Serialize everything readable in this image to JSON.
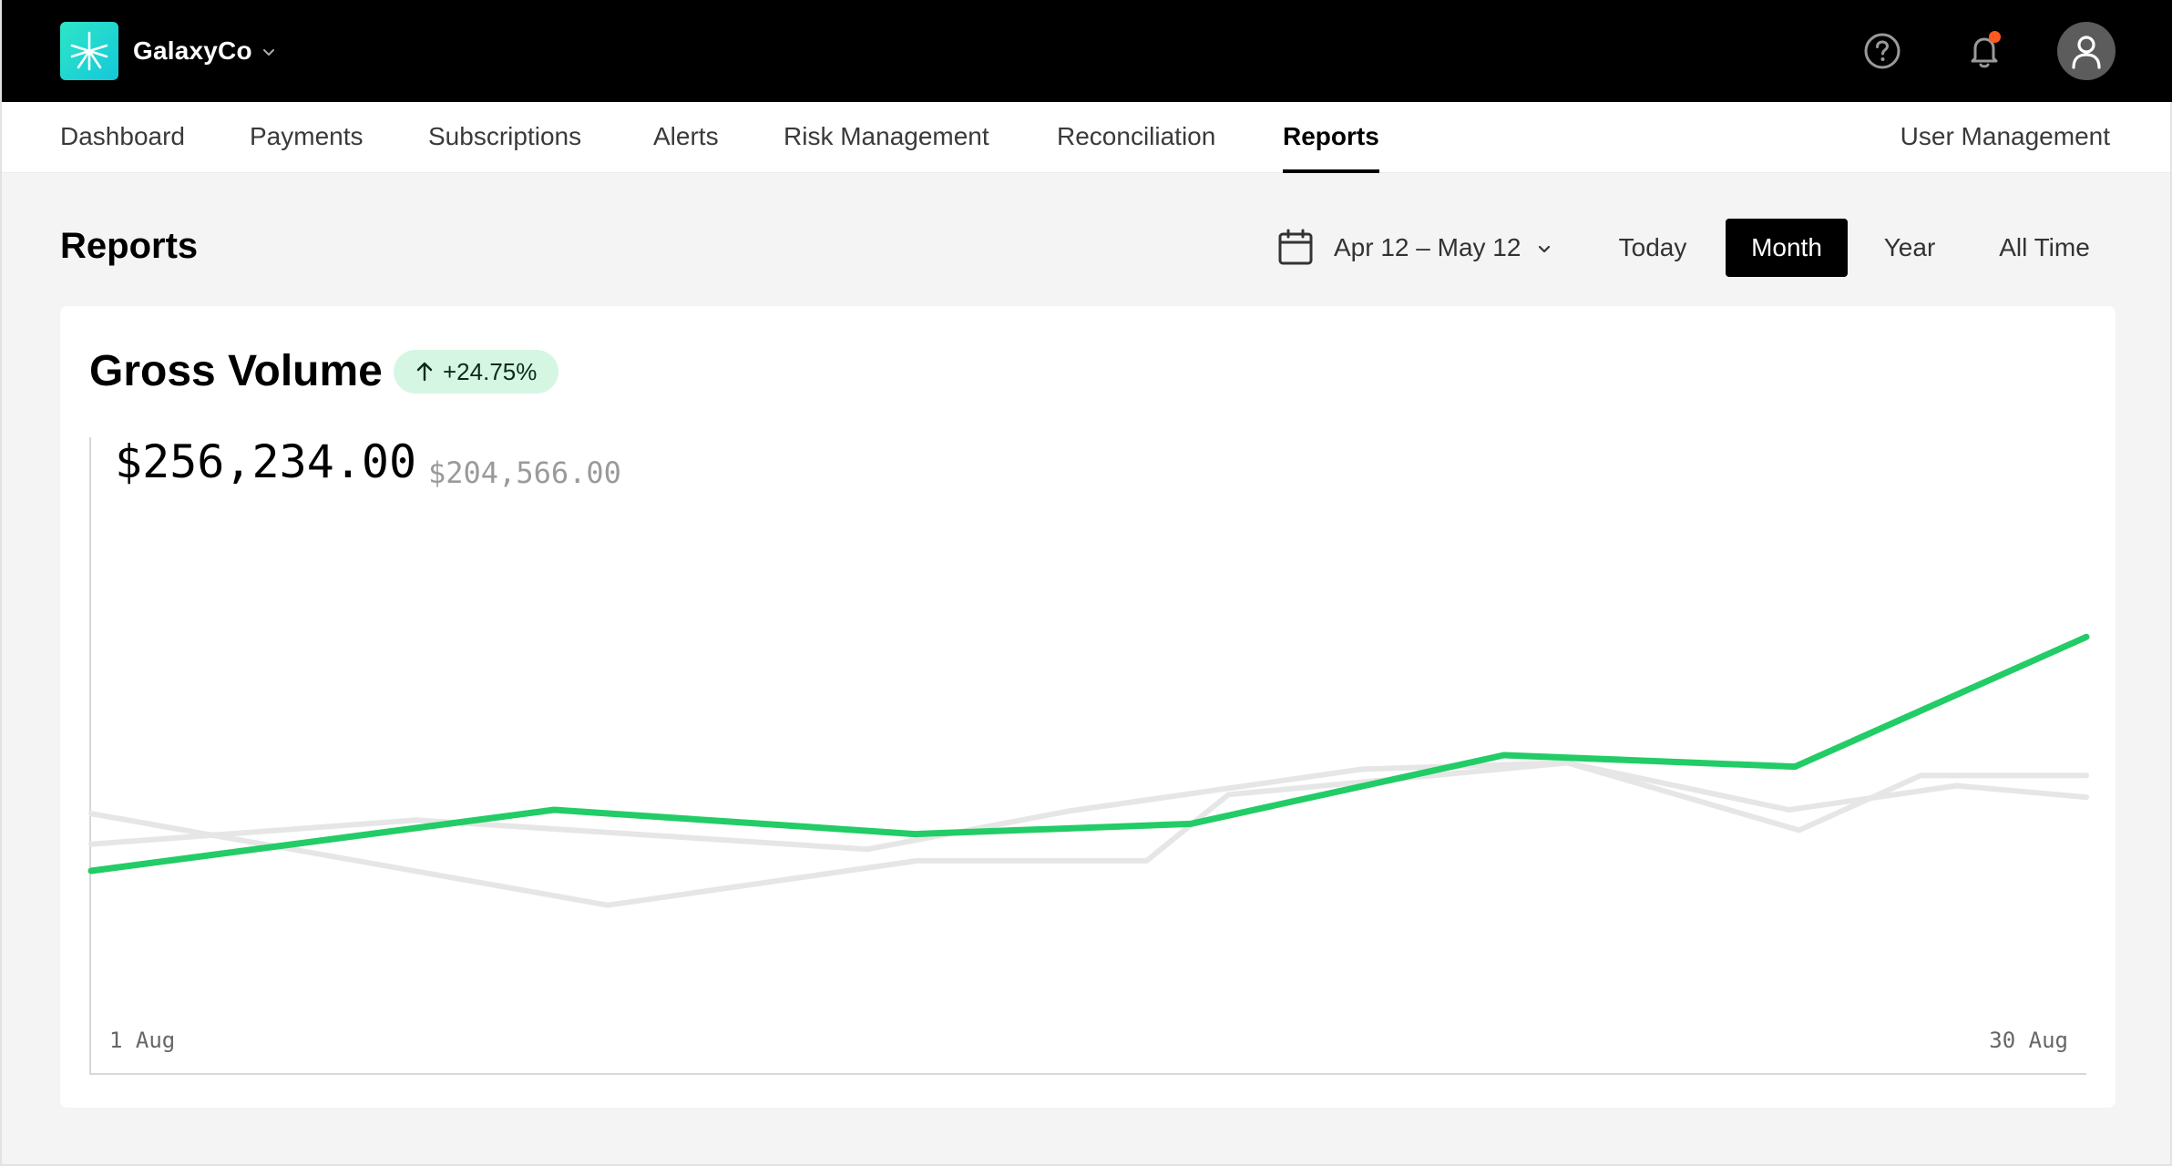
{
  "brand": {
    "name": "GalaxyCo",
    "logo_icon": "asterisk-logo-icon",
    "accent": "#22d3c5"
  },
  "topbar": {
    "help_icon": "help-circle-icon",
    "notifications_icon": "bell-icon",
    "notification_dot_color": "#ff5a1f",
    "avatar_icon": "user-icon"
  },
  "nav": {
    "items": [
      {
        "label": "Dashboard",
        "active": false
      },
      {
        "label": "Payments",
        "active": false
      },
      {
        "label": "Subscriptions",
        "active": false
      },
      {
        "label": "Alerts",
        "active": false
      },
      {
        "label": "Risk Management",
        "active": false
      },
      {
        "label": "Reconciliation",
        "active": false
      },
      {
        "label": "Reports",
        "active": true
      }
    ],
    "right_item": "User Management"
  },
  "page": {
    "title": "Reports",
    "date_range": "Apr 12 – May 12",
    "ranges": [
      {
        "label": "Today",
        "active": false
      },
      {
        "label": "Month",
        "active": true
      },
      {
        "label": "Year",
        "active": false
      },
      {
        "label": "All Time",
        "active": false
      }
    ]
  },
  "card": {
    "title": "Gross Volume",
    "change": "+24.75%",
    "change_color": "#d6f6e4",
    "value": "$256,234.00",
    "previous_value": "$204,566.00"
  },
  "chart_data": {
    "type": "line",
    "x_start_label": "1 Aug",
    "x_end_label": "30 Aug",
    "grid": false,
    "series": [
      {
        "color": "#22cc66",
        "x": [
          0,
          0.232,
          0.413,
          0.551,
          0.708,
          0.854,
          1
        ],
        "y": [
          0.318,
          0.414,
          0.376,
          0.392,
          0.5,
          0.482,
          0.686
        ]
      },
      {
        "color": "#e6e6e6",
        "x": [
          0,
          0.163,
          0.389,
          0.49,
          0.637,
          0.74,
          0.851,
          0.935,
          1
        ],
        "y": [
          0.36,
          0.398,
          0.352,
          0.412,
          0.478,
          0.488,
          0.414,
          0.452,
          0.434
        ]
      },
      {
        "color": "#e6e6e6",
        "x": [
          0,
          0.259,
          0.414,
          0.529,
          0.57,
          0.74,
          0.856,
          0.917,
          1
        ],
        "y": [
          0.408,
          0.264,
          0.334,
          0.334,
          0.438,
          0.488,
          0.382,
          0.468,
          0.468
        ]
      }
    ]
  }
}
